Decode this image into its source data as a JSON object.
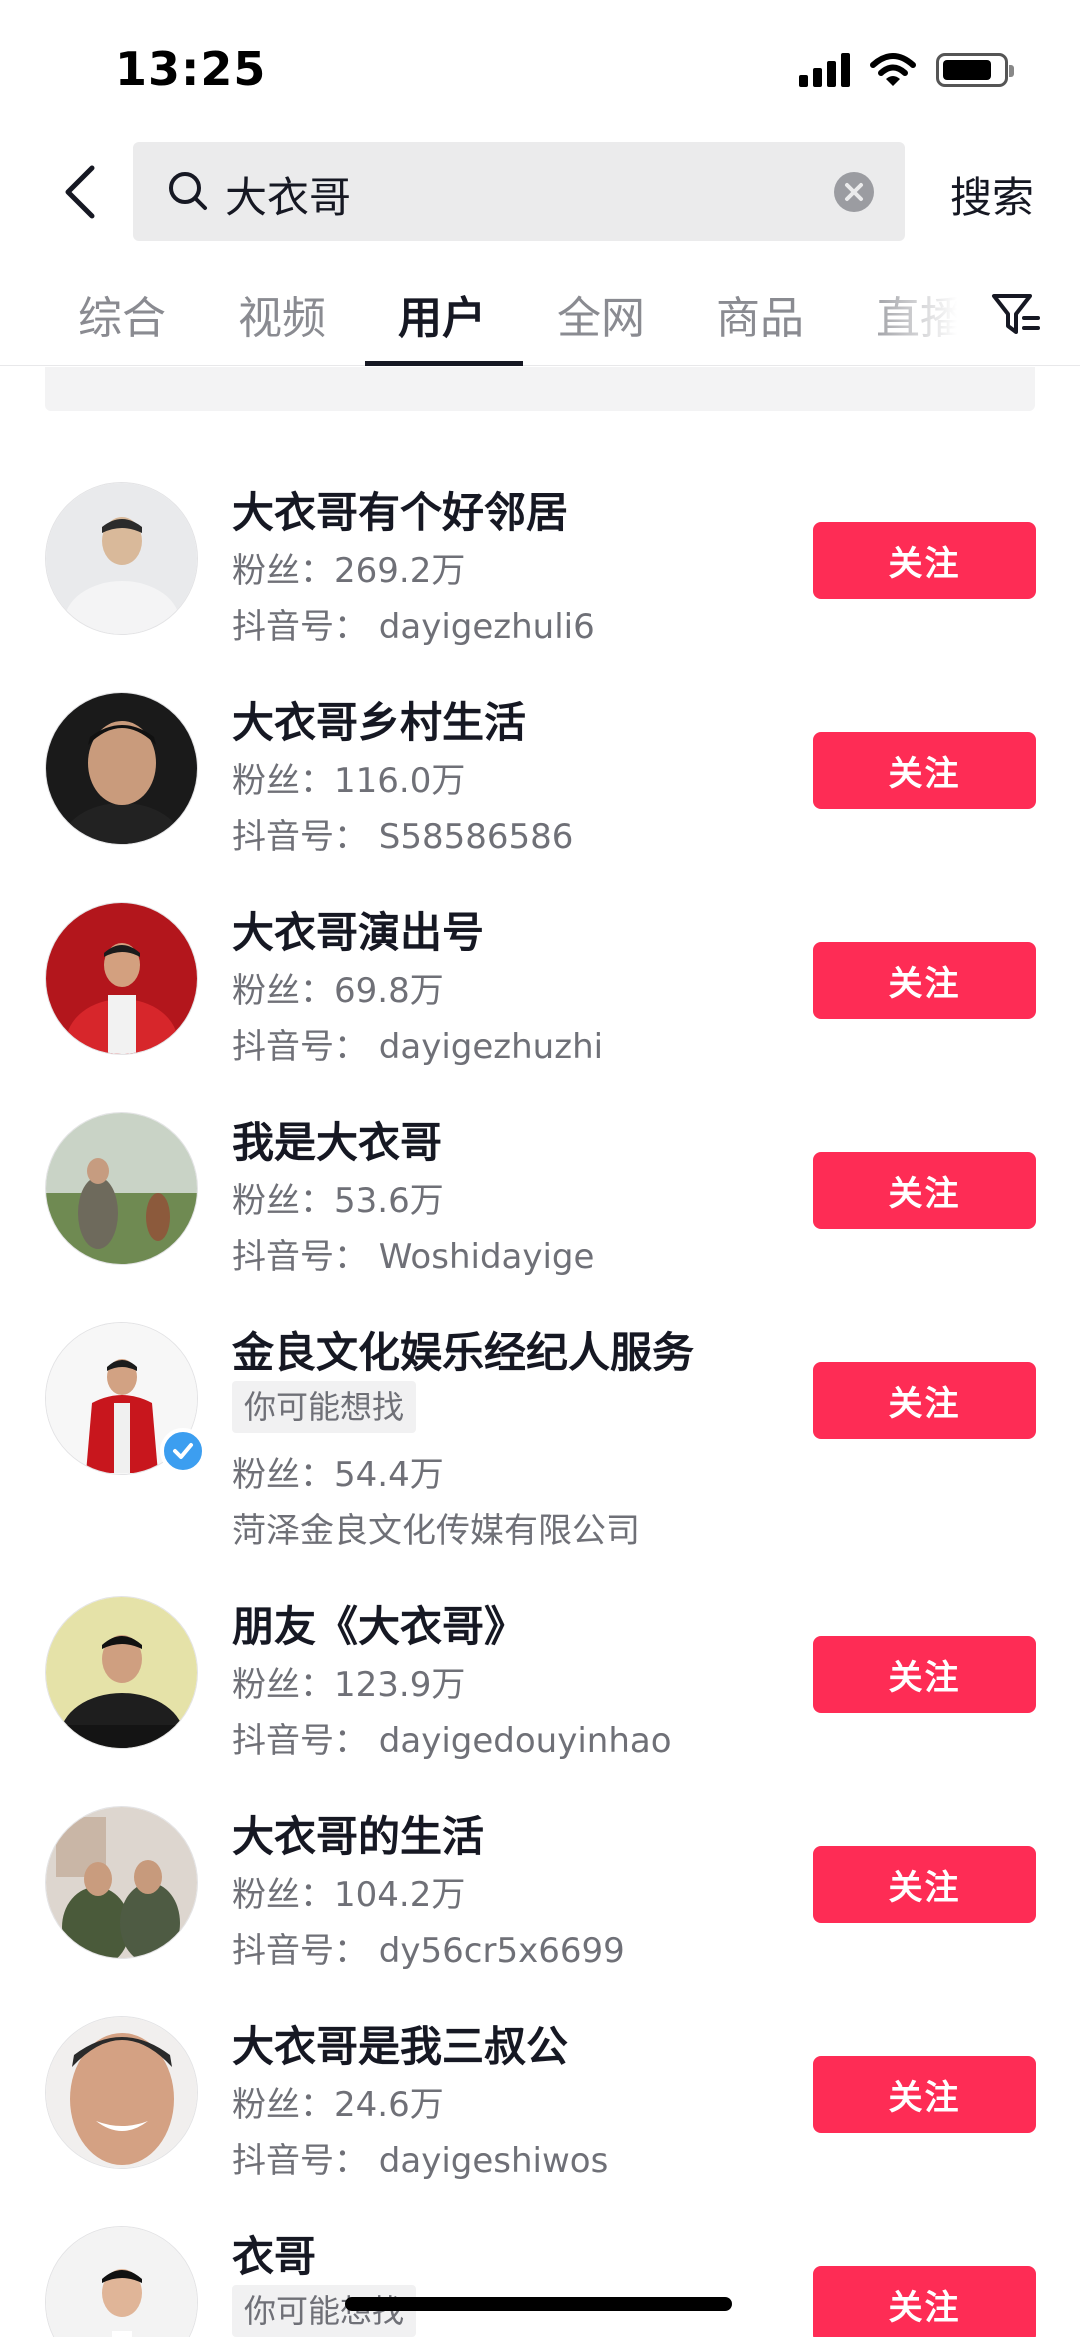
{
  "status_bar": {
    "time": "13:25"
  },
  "search": {
    "query": "大衣哥",
    "submit_label": "搜索"
  },
  "tabs": [
    {
      "label": "综合"
    },
    {
      "label": "视频"
    },
    {
      "label": "用户"
    },
    {
      "label": "全网"
    },
    {
      "label": "商品"
    },
    {
      "label": "直播"
    }
  ],
  "active_tab": "用户",
  "users": [
    {
      "name": "大衣哥有个好邻居",
      "fans": "粉丝：269.2万",
      "account": "抖音号：  dayigezhuli6",
      "follow": "关注"
    },
    {
      "name": "大衣哥乡村生活",
      "fans": "粉丝：116.0万",
      "account": "抖音号：  S58586586",
      "follow": "关注"
    },
    {
      "name": "大衣哥演出号",
      "fans": "粉丝：69.8万",
      "account": "抖音号：  dayigezhuzhi",
      "follow": "关注"
    },
    {
      "name": "我是大衣哥",
      "fans": "粉丝：53.6万",
      "account": "抖音号：  Woshidayige",
      "follow": "关注"
    },
    {
      "name": "金良文化娱乐经纪人服务",
      "tag": "你可能想找",
      "fans": "粉丝：54.4万",
      "account": "菏泽金良文化传媒有限公司",
      "follow": "关注",
      "verified": true
    },
    {
      "name": "朋友《大衣哥》",
      "fans": "粉丝：123.9万",
      "account": "抖音号：  dayigedouyinhao",
      "follow": "关注"
    },
    {
      "name": "大衣哥的生活",
      "fans": "粉丝：104.2万",
      "account": "抖音号：  dy56cr5x6699",
      "follow": "关注"
    },
    {
      "name": "大衣哥是我三叔公",
      "fans": "粉丝：24.6万",
      "account": "抖音号：  dayigeshiwos",
      "follow": "关注"
    },
    {
      "name": "衣哥",
      "tag": "你可能想找",
      "follow": "关注"
    }
  ],
  "colors": {
    "follow_button": "#fe2c55",
    "verified_badge": "#3c9ef0"
  },
  "icons": [
    "back-arrow-icon",
    "search-icon",
    "clear-icon",
    "filter-icon",
    "verified-icon",
    "signal-icon",
    "wifi-icon",
    "battery-icon"
  ]
}
